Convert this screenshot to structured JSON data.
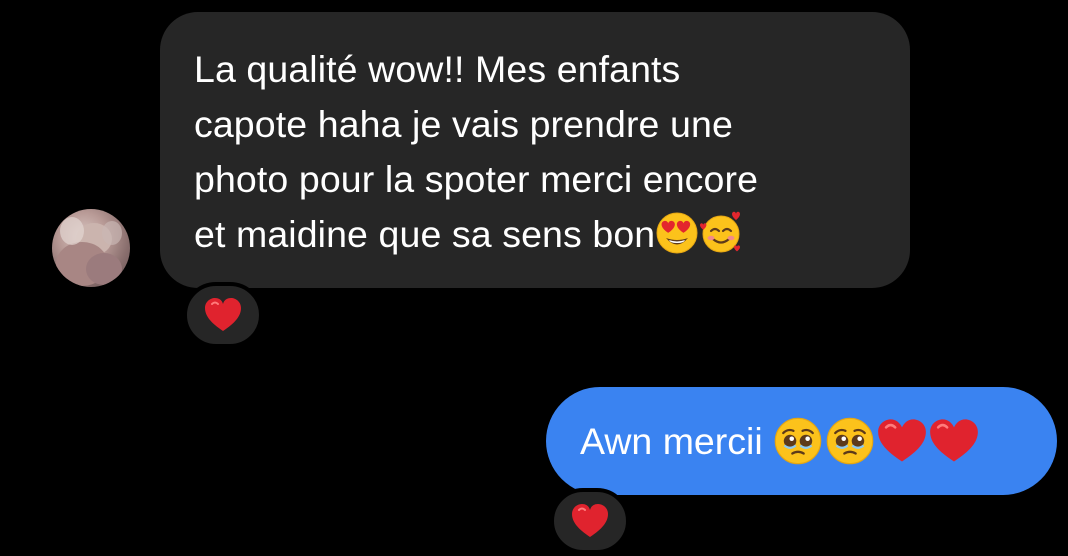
{
  "conversation": {
    "incoming": {
      "lines": [
        "La qualité wow!! Mes enfants",
        "capote haha je vais prendre une",
        "photo pour la spoter merci encore",
        "et maidine que sa sens bon"
      ],
      "trailing_emojis": [
        "heart-eyes-emoji",
        "smiling-face-with-hearts-emoji"
      ],
      "reaction": "red-heart-emoji"
    },
    "outgoing": {
      "text": "Awn mercii",
      "trailing_emojis": [
        "pleading-face-emoji",
        "pleading-face-emoji",
        "red-heart-emoji",
        "red-heart-emoji"
      ],
      "reaction": "red-heart-emoji"
    }
  },
  "colors": {
    "background": "#000000",
    "incoming_bubble": "#262626",
    "outgoing_bubble": "#3a83f1",
    "text": "#ffffff",
    "heart": "#e0232e"
  }
}
